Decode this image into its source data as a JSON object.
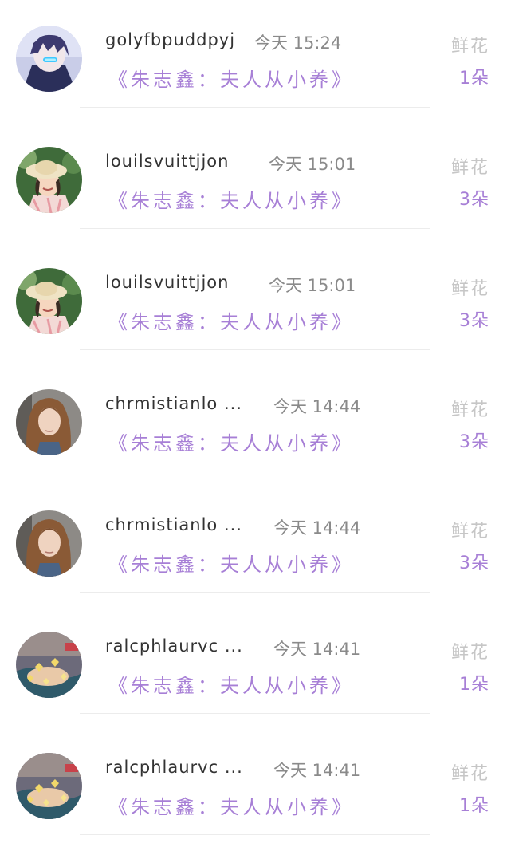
{
  "rows": [
    {
      "name": "golyfbpuddpyj",
      "time": "今天 15:24",
      "book": "《朱志鑫：夫人从小养》",
      "flower_label": "鲜花",
      "flower_count": "1朵",
      "avatar": "anime-boy-avatar"
    },
    {
      "name": "louilsvuittjjon",
      "time": "今天 15:01",
      "book": "《朱志鑫：夫人从小养》",
      "flower_label": "鲜花",
      "flower_count": "3朵",
      "avatar": "girl-hat-avatar"
    },
    {
      "name": "louilsvuittjjon",
      "time": "今天 15:01",
      "book": "《朱志鑫：夫人从小养》",
      "flower_label": "鲜花",
      "flower_count": "3朵",
      "avatar": "girl-hat-avatar"
    },
    {
      "name": "chrmistianlo ...",
      "time": "今天 14:44",
      "book": "《朱志鑫：夫人从小养》",
      "flower_label": "鲜花",
      "flower_count": "3朵",
      "avatar": "long-hair-girl-avatar"
    },
    {
      "name": "chrmistianlo ...",
      "time": "今天 14:44",
      "book": "《朱志鑫：夫人从小养》",
      "flower_label": "鲜花",
      "flower_count": "3朵",
      "avatar": "long-hair-girl-avatar"
    },
    {
      "name": "ralcphlaurvc ...",
      "time": "今天 14:41",
      "book": "《朱志鑫：夫人从小养》",
      "flower_label": "鲜花",
      "flower_count": "1朵",
      "avatar": "hands-hearts-avatar"
    },
    {
      "name": "ralcphlaurvc ...",
      "time": "今天 14:41",
      "book": "《朱志鑫：夫人从小养》",
      "flower_label": "鲜花",
      "flower_count": "1朵",
      "avatar": "hands-hearts-avatar"
    }
  ],
  "colors": {
    "accent_purple": "#a77fd6",
    "name_text": "#333333",
    "time_text": "#8a8a8a",
    "flower_label": "#c6c6c6",
    "divider": "#ececec"
  }
}
